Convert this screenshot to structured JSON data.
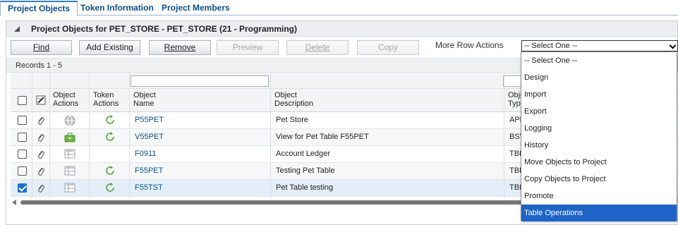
{
  "tabs": [
    {
      "label": "Project Objects",
      "active": true
    },
    {
      "label": "Token Information",
      "active": false
    },
    {
      "label": "Project Members",
      "active": false
    }
  ],
  "panel": {
    "title": "Project Objects for PET_STORE - PET_STORE  (21 - Programming)"
  },
  "toolbar": {
    "find": "Find",
    "add_existing": "Add Existing",
    "remove": "Remove",
    "preview": "Preview",
    "delete": "Delete",
    "copy": "Copy",
    "more_row_actions": "More Row Actions",
    "select_value": "-- Select One --"
  },
  "records": "Records 1 - 5",
  "columns": {
    "object_actions": [
      "Object",
      "Actions"
    ],
    "token_actions": [
      "Token",
      "Actions"
    ],
    "object_name": [
      "Object",
      "Name"
    ],
    "object_description": [
      "Object",
      "Description"
    ],
    "object_type": [
      "Obje",
      "Type"
    ]
  },
  "rows": [
    {
      "name": "P55PET",
      "description": "Pet Store",
      "type": "APPL",
      "checked": false,
      "object_icon": "globe-icon",
      "token_icon": "refresh-icon"
    },
    {
      "name": "V55PET",
      "description": "View for Pet Table F55PET",
      "type": "BSVW",
      "checked": false,
      "object_icon": "briefcase-icon",
      "token_icon": "refresh-icon"
    },
    {
      "name": "F0911",
      "description": "Account Ledger",
      "type": "TBLE",
      "checked": false,
      "object_icon": "table-icon",
      "token_icon": ""
    },
    {
      "name": "F55PET",
      "description": "Testing Pet Table",
      "type": "TBLE",
      "checked": false,
      "object_icon": "table-icon",
      "token_icon": "refresh-icon"
    },
    {
      "name": "F55TST",
      "description": "Pet Table testing",
      "type": "TBLE",
      "checked": true,
      "object_icon": "table-icon",
      "token_icon": "refresh-icon"
    }
  ],
  "dropdown": {
    "options": [
      "-- Select One --",
      "Design",
      "Import",
      "Export",
      "Logging",
      "History",
      "Move Objects to Project",
      "Copy Objects to Project",
      "Promote",
      "Table Operations"
    ],
    "highlighted": "Table Operations"
  },
  "colors": {
    "link": "#0b4f8a",
    "highlight": "#1e63c8",
    "icon_green": "#5aa63c"
  }
}
